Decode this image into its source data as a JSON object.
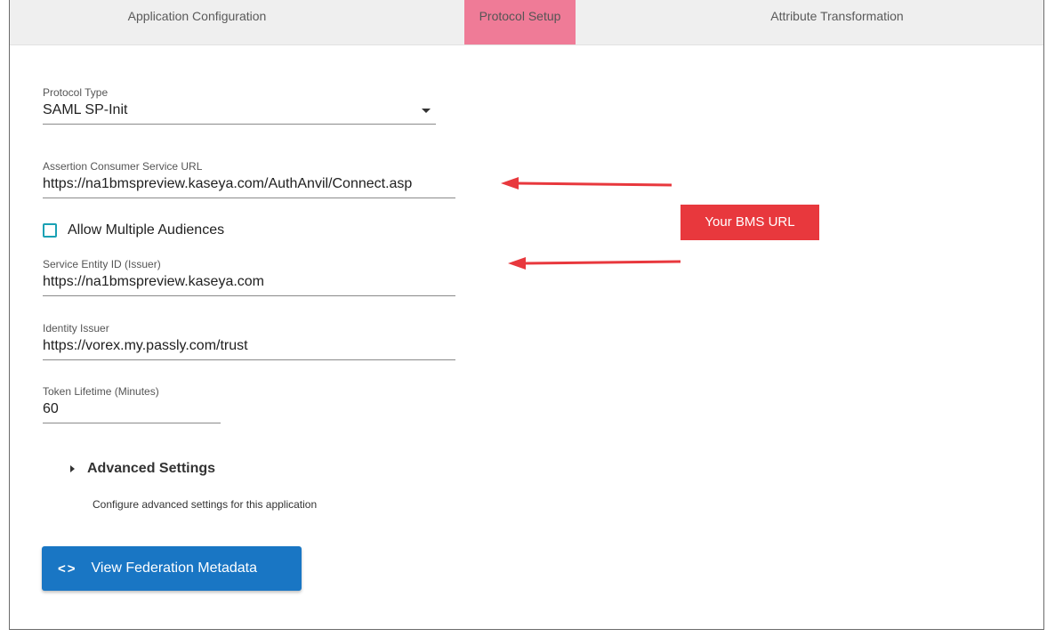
{
  "tabs": [
    {
      "label": "Application Configuration"
    },
    {
      "label": "Protocol Setup"
    },
    {
      "label": "Attribute Transformation"
    }
  ],
  "protocol_type": {
    "label": "Protocol Type",
    "value": "SAML SP-Init"
  },
  "acs_url": {
    "label": "Assertion Consumer Service URL",
    "value": "https://na1bmspreview.kaseya.com/AuthAnvil/Connect.asp"
  },
  "allow_multiple": {
    "label": "Allow Multiple Audiences",
    "checked": false
  },
  "service_entity": {
    "label": "Service Entity ID (Issuer)",
    "value": "https://na1bmspreview.kaseya.com"
  },
  "identity_issuer": {
    "label": "Identity Issuer",
    "value": "https://vorex.my.passly.com/trust"
  },
  "token_lifetime": {
    "label": "Token Lifetime (Minutes)",
    "value": "60"
  },
  "advanced": {
    "title": "Advanced Settings",
    "description": "Configure advanced settings for this application"
  },
  "metadata_button": {
    "icon": "<>",
    "label": "View Federation Metadata"
  },
  "annotation": {
    "text": "Your BMS URL",
    "color": "#e8383d"
  },
  "colors": {
    "active_tab": "#ef7b97",
    "button": "#1976c4",
    "checkbox": "#1aa1b4"
  }
}
